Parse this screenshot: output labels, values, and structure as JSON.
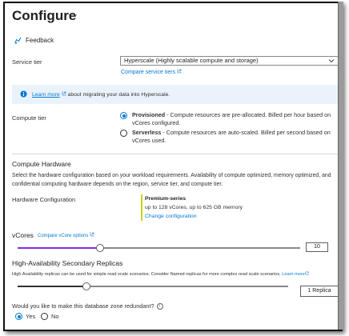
{
  "page": {
    "title": "Configure",
    "more_actions": "···"
  },
  "toolbar": {
    "feedback_label": "Feedback"
  },
  "service_tier": {
    "label": "Service tier",
    "selected": "Hyperscale (Highly scalable compute and storage)",
    "compare_link": "Compare service tiers"
  },
  "info_banner": {
    "link": "Learn more",
    "text": "about migrating your data into Hyperscale."
  },
  "compute_tier": {
    "label": "Compute tier",
    "options": [
      {
        "name": "Provisioned",
        "desc": " - Compute resources are pre-allocated. Billed per hour based on",
        "desc2": "vCores configured.",
        "selected": true
      },
      {
        "name": "Serverless",
        "desc": " - Compute resources are auto-scaled. Billed per second based on",
        "desc2": "vCores used.",
        "selected": false
      }
    ]
  },
  "compute_hardware": {
    "heading": "Compute Hardware",
    "description_line1": "Select the hardware configuration based on your workload requirements. Availability of compute optimized, memory optimized, and",
    "description_line2": "confidential computing hardware depends on the region, service tier, and compute tier.",
    "config_label": "Hardware Configuration",
    "config_name": "Premium-series",
    "config_detail": "up to 128 vCores, up to 625 GB memory",
    "change_link": "Change configuration"
  },
  "vcores": {
    "label": "vCores",
    "compare_link": "Compare vCore options",
    "value": "10",
    "slider_fraction": 0.29,
    "fill_color": "#8a2be2"
  },
  "ha_replicas": {
    "heading": "High-Availability Secondary Replicas",
    "description": "High Availability replicas can be used for simple read scale scenarios. Consider Named replicas for more complex read scale scenarios.",
    "learn_more": "Learn more",
    "value": "1 Replica",
    "slider_fraction": 0.25,
    "fill_color": "#323130"
  },
  "zone_redundancy": {
    "question": "Would you like to make this database zone redundant?",
    "info_icon": "i",
    "options": [
      {
        "label": "Yes",
        "selected": true
      },
      {
        "label": "No",
        "selected": false
      }
    ]
  },
  "colors": {
    "accent": "#0078d4",
    "hardware_bar": "#c8d400",
    "info_bg": "#eaf3fb"
  }
}
